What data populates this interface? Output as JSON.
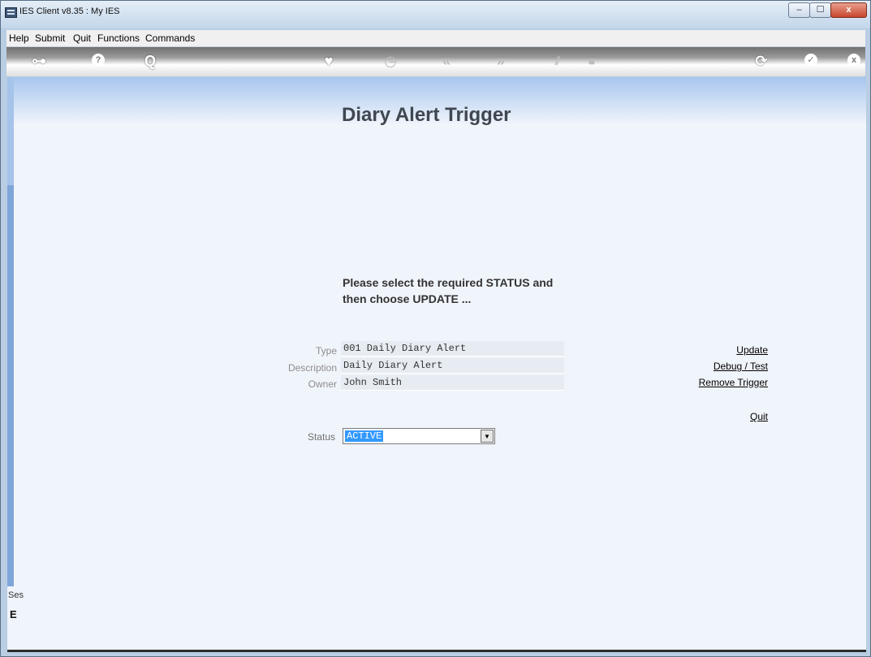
{
  "window": {
    "title": "IES Client v8.35 : My IES",
    "min_label": "–",
    "max_label": "☐",
    "close_label": "x"
  },
  "menu": [
    "Help",
    "Submit",
    "Quit",
    "Functions",
    "Commands"
  ],
  "toolbar": {
    "icons": [
      "key-icon",
      "help-icon",
      "search-icon",
      "favorite-heart-icon",
      "history-clock-icon",
      "rewind-icon",
      "fast-forward-icon",
      "tools-icon",
      "stop-icon",
      "refresh-icon",
      "accept-icon",
      "close-icon"
    ],
    "glyphs": {
      "key": "⊶",
      "help": "?",
      "search": "Q",
      "heart": "♥",
      "clock": "◷",
      "rewind": "«",
      "forward": "»",
      "tools": "⫽",
      "stop": "■",
      "refresh": "⟳",
      "check": "✓",
      "close": "x"
    }
  },
  "page": {
    "title": "Diary Alert Trigger",
    "instruction_line1": "Please select the required STATUS and",
    "instruction_line2": "then choose UPDATE ..."
  },
  "fields": {
    "type_label": "Type",
    "type_value": "001 Daily Diary Alert",
    "description_label": "Description",
    "description_value": "Daily Diary Alert",
    "owner_label": "Owner",
    "owner_value": "John Smith"
  },
  "actions": {
    "update": "Update",
    "debug_test": "Debug / Test",
    "remove_trigger": "Remove Trigger",
    "quit": "Quit"
  },
  "status": {
    "label": "Status",
    "value": "ACTIVE",
    "arrow": "▼"
  },
  "session": {
    "label": "Ses",
    "glyph": "E"
  }
}
